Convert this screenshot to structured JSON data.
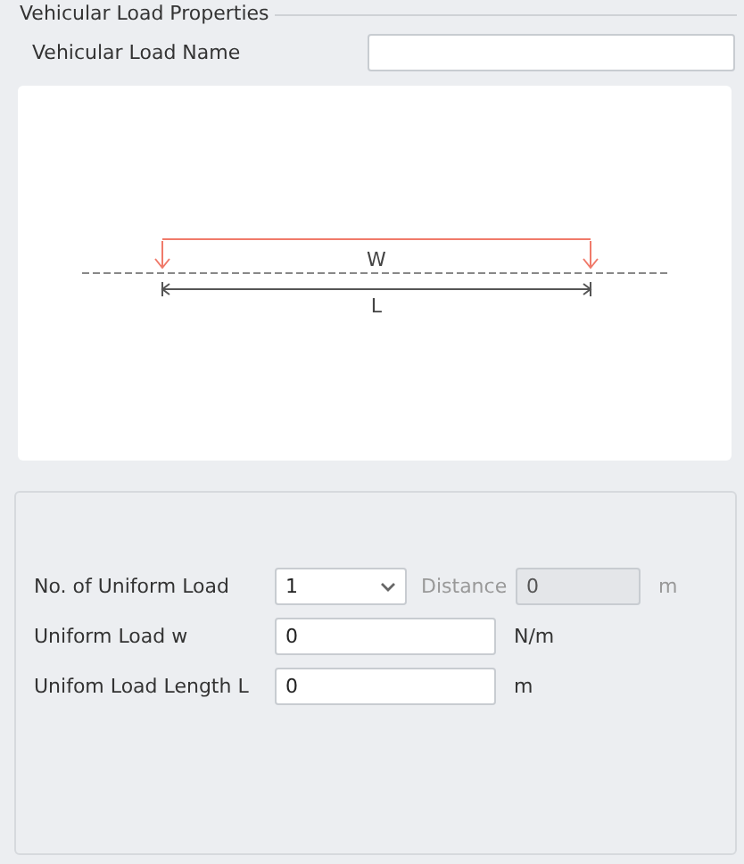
{
  "group_title": "Vehicular Load Properties",
  "name_field": {
    "label": "Vehicular Load Name"
  },
  "diagram": {
    "load_label": "W",
    "length_label": "L"
  },
  "count_field": {
    "label": "No. of Uniform Load",
    "value": "1"
  },
  "distance_field": {
    "label": "Distance",
    "value": "0",
    "unit": "m",
    "disabled": true
  },
  "load_fields": [
    {
      "label": "Uniform Load w",
      "value": "0",
      "unit": "N/m"
    },
    {
      "label": "Unifom Load Length L",
      "value": "0",
      "unit": "m"
    }
  ]
}
